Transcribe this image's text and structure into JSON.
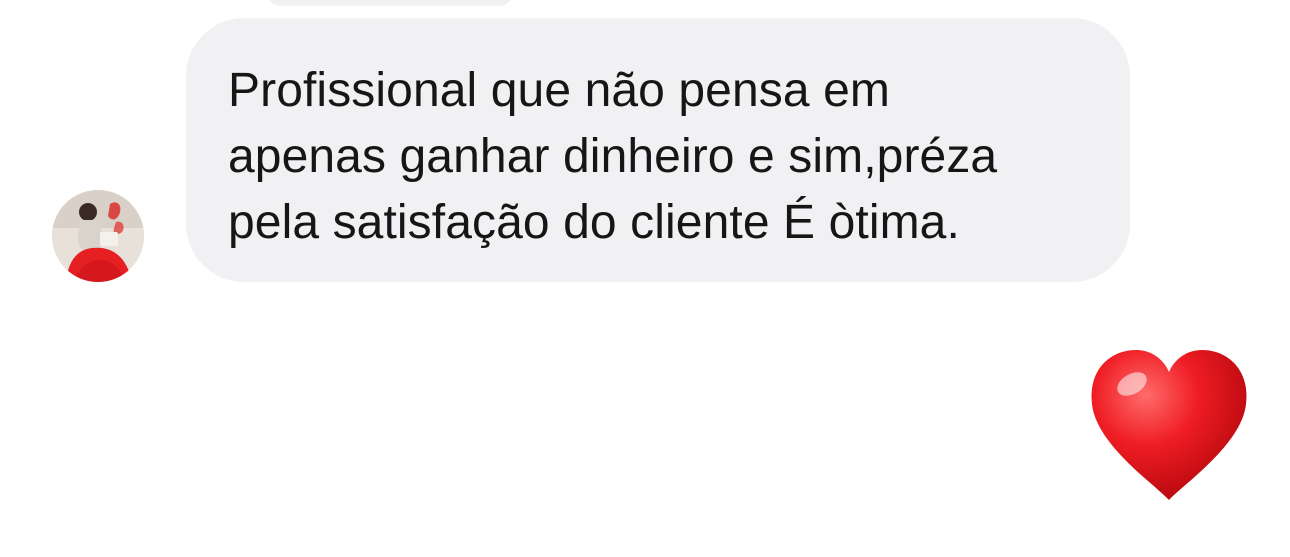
{
  "conversation": {
    "incoming_message": {
      "avatar": "sender-avatar-photo",
      "lines": [
        "Profissional que não pensa em",
        "apenas ganhar dinheiro e sim,préza",
        "pela satisfação do cliente É òtima."
      ]
    },
    "reaction": {
      "icon": "heart-icon",
      "color": "#e8121c"
    }
  },
  "colors": {
    "bubble_background": "#f1f1f4",
    "message_text": "#161616",
    "page_background": "#ffffff"
  }
}
